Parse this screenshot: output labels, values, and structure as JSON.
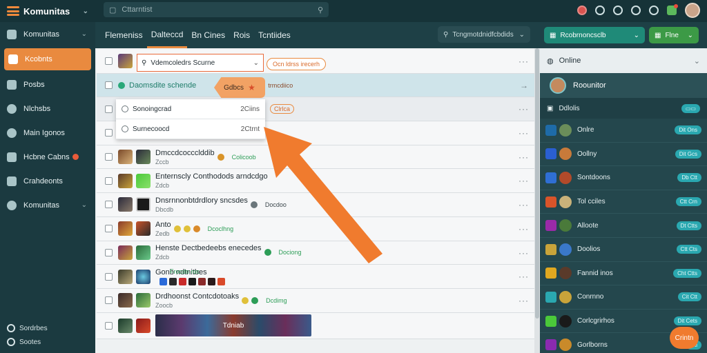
{
  "app": {
    "title": "Komunitas"
  },
  "search": {
    "placeholder": "Cttarntist"
  },
  "sidebar": {
    "items": [
      {
        "label": "Komunitas",
        "icon": "community-icon"
      },
      {
        "label": "Kcobnts",
        "icon": "home-icon"
      },
      {
        "label": "Posbs",
        "icon": "posts-icon"
      },
      {
        "label": "Nlchsbs",
        "icon": "notifications-icon"
      },
      {
        "label": "Main Igonos",
        "icon": "games-icon"
      },
      {
        "label": "Hcbne Cabns",
        "icon": "chart-icon"
      },
      {
        "label": "Crahdeonts",
        "icon": "puzzle-icon"
      },
      {
        "label": "Komunitas",
        "icon": "community-icon"
      }
    ],
    "footer": [
      "Sordrbes",
      "Sootes"
    ]
  },
  "tabs": [
    {
      "label": "Flemeniss"
    },
    {
      "label": "Dalteccd"
    },
    {
      "label": "Bn Cines"
    },
    {
      "label": "Rois"
    },
    {
      "label": "Tcntiides"
    }
  ],
  "tab_dropdown": {
    "label": "Tcngmotdnidfcbdids"
  },
  "popup": {
    "search_value": "Vdemcoledrs Scurne",
    "chip": "Ocn ldrss irecerh",
    "highlight_row_label": "Daomsdite schende",
    "highlight_row_tag": "trmcdiico",
    "highlight_chip": "Gdbcs",
    "menu": [
      {
        "label": "Sonoingcrad",
        "time": "2Ciins"
      },
      {
        "label": "Surnecoocd",
        "time": "2Ctrnt"
      }
    ]
  },
  "rows": [
    {
      "title": "",
      "sub": "",
      "chip": ""
    },
    {
      "title": "",
      "sub": "",
      "chip": ""
    },
    {
      "title": "",
      "sub": "",
      "chip": "Clrlca"
    },
    {
      "title": "",
      "sub": "",
      "chip": ""
    },
    {
      "title": "Dmccdcoccclddib",
      "sub": "Zccb",
      "chip": "Colicoob"
    },
    {
      "title": "Enternscly Conthodods arndcdgo",
      "sub": "Zdcb",
      "chip": ""
    },
    {
      "title": "Dnsrnnonbtdrdlory sncsdes",
      "sub": "Dbcdb",
      "chip": "Docdoo"
    },
    {
      "title": "Anto",
      "sub": "Zedb",
      "chip": "Dcoclhng"
    },
    {
      "title": "Henste Dectbedeebs enecedes",
      "sub": "Zdcb",
      "chip": "Dociong"
    },
    {
      "title": "Gonb ndtnitbes",
      "sub": "Frocdo roc",
      "chip": ""
    },
    {
      "title": "Drdhoonst Contcdotoaks",
      "sub": "Zoocb",
      "chip": "Dcdimg"
    },
    {
      "title": "",
      "sub": "",
      "chip": "",
      "banner": "Tdniab"
    }
  ],
  "right_panel": {
    "dropdown1": "Rcobrnoncsclb",
    "dropdown2": "Flne",
    "online_label": "Online",
    "user_name": "Roounitor",
    "section": "Ddlolis",
    "friends": [
      {
        "name": "Onlre",
        "status": "Dit Ons",
        "sq": "#1e6ba8",
        "ci": "#6b8e5a"
      },
      {
        "name": "Oollny",
        "status": "Dit Gcs",
        "sq": "#2a5fd1",
        "ci": "#c77a3a"
      },
      {
        "name": "Sontdoons",
        "status": "Db Ctt",
        "sq": "#2f6fd4",
        "ci": "#b24a2a"
      },
      {
        "name": "Tol cciles",
        "status": "Ctt Crn",
        "sq": "#d9542a",
        "ci": "#c9b27a"
      },
      {
        "name": "Alloote",
        "status": "Dt Ctts",
        "sq": "#9a2aa8",
        "ci": "#4a7a3a"
      },
      {
        "name": "Doolios",
        "status": "Ctt Cts",
        "sq": "#c9a43a",
        "ci": "#3a78c9"
      },
      {
        "name": "Fannid inos",
        "status": "Cht Ctts",
        "sq": "#e0a820",
        "ci": "#5a3a2a"
      },
      {
        "name": "Conrnno",
        "status": "Cit Ctt",
        "sq": "#2aa8b0",
        "ci": "#c9a43a"
      },
      {
        "name": "Corlcgrirhos",
        "status": "Dit Cets",
        "sq": "#4bc93a",
        "ci": "#1a1a1a"
      },
      {
        "name": "Gorlborns",
        "status": "Cti",
        "sq": "#8a2ab0",
        "ci": "#c98a2a"
      }
    ],
    "fab_label": "Crintn"
  },
  "colors": {
    "accent": "#e98a3f",
    "teal": "#1f8a78",
    "sidebar_bg": "#1b3a40"
  }
}
